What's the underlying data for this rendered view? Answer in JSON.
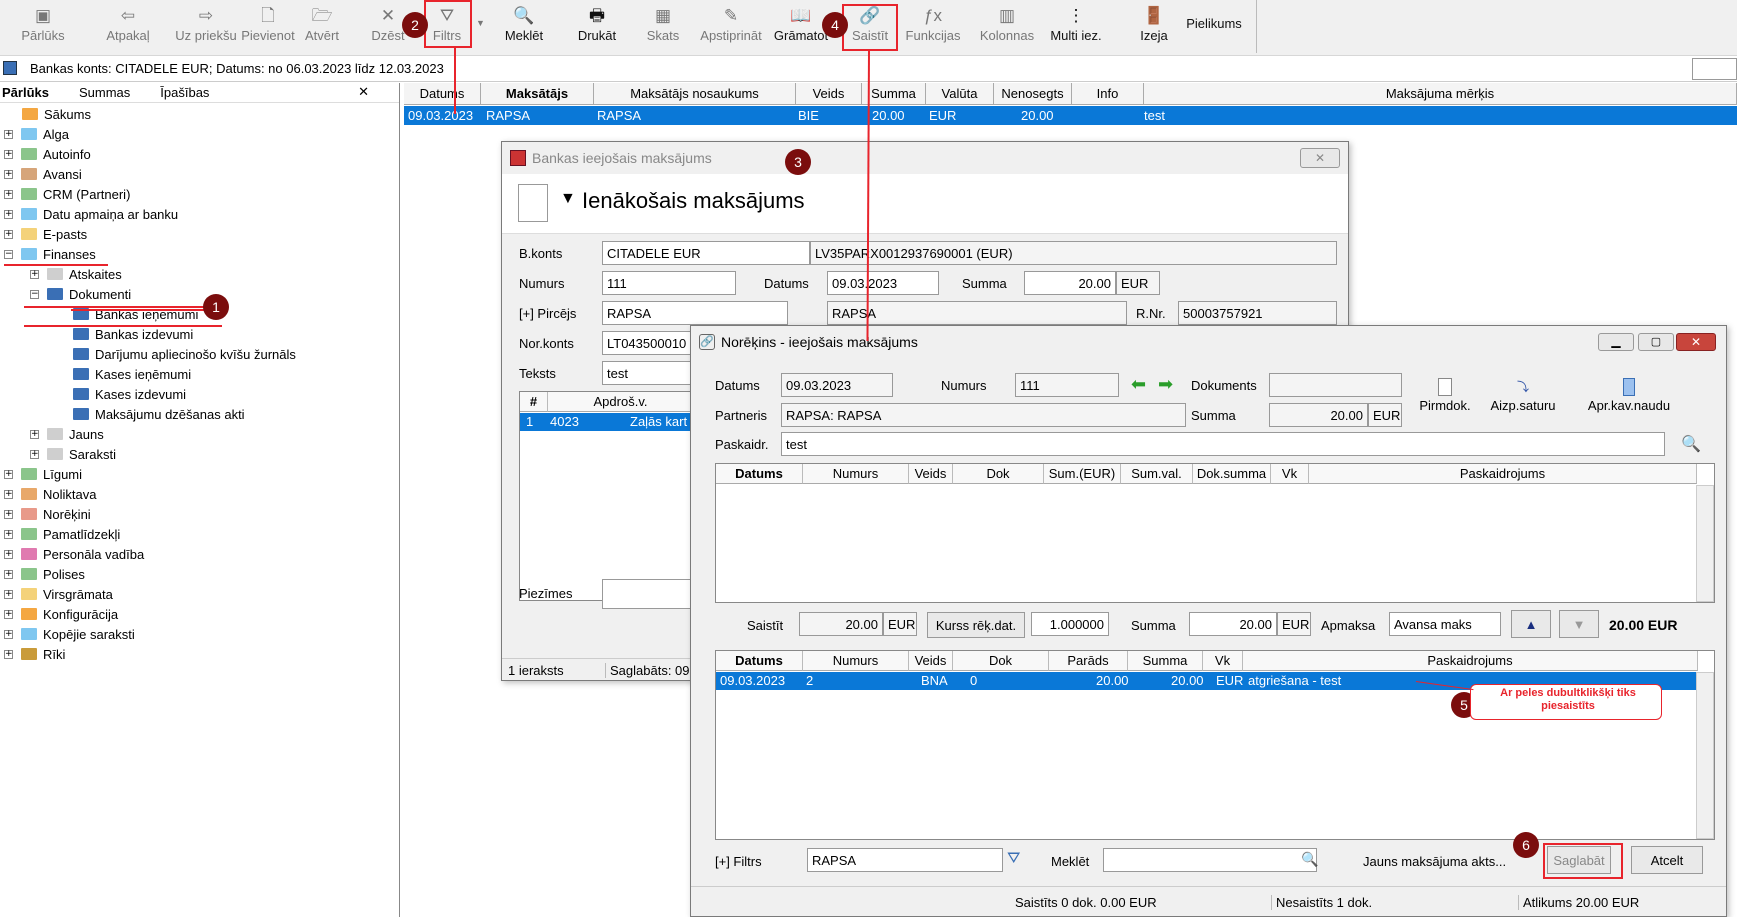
{
  "toolbar": {
    "items": [
      {
        "label": "Pārlūks",
        "icon": "browser-icon",
        "glyph": "▣",
        "enabled": false
      },
      {
        "label": "Atpakaļ",
        "icon": "back-arrow-icon",
        "glyph": "⇦",
        "enabled": false
      },
      {
        "label": "Uz priekšu",
        "icon": "forward-arrow-icon",
        "glyph": "⇨",
        "enabled": false
      },
      {
        "label": "Pievienot",
        "icon": "new-document-icon",
        "glyph": "🗋",
        "enabled": false
      },
      {
        "label": "Atvērt",
        "icon": "open-folder-icon",
        "glyph": "🗁",
        "enabled": false
      },
      {
        "label": "Dzēst",
        "icon": "delete-x-icon",
        "glyph": "✕",
        "enabled": false
      },
      {
        "label": "Filtrs",
        "icon": "filter-icon",
        "glyph": "⛛",
        "enabled": false
      },
      {
        "label": "Meklēt",
        "icon": "search-icon",
        "glyph": "🔍",
        "enabled": true
      },
      {
        "label": "Drukāt",
        "icon": "printer-icon",
        "glyph": "🖶",
        "enabled": true
      },
      {
        "label": "Skats",
        "icon": "view-grid-icon",
        "glyph": "▦",
        "enabled": false
      },
      {
        "label": "Apstiprināt",
        "icon": "approve-icon",
        "glyph": "✎",
        "enabled": false
      },
      {
        "label": "Grāmatot",
        "icon": "book-icon",
        "glyph": "📖",
        "enabled": true
      },
      {
        "label": "Saistīt",
        "icon": "link-icon",
        "glyph": "🔗",
        "enabled": false
      },
      {
        "label": "Funkcijas",
        "icon": "function-icon",
        "glyph": "ƒx",
        "enabled": false
      },
      {
        "label": "Kolonnas",
        "icon": "columns-icon",
        "glyph": "▥",
        "enabled": false
      },
      {
        "label": "Multi iez.",
        "icon": "more-vertical-icon",
        "glyph": "⋮",
        "enabled": true
      },
      {
        "label": "Izeja",
        "icon": "exit-door-icon",
        "glyph": "🚪",
        "enabled": true
      }
    ],
    "extra_label": "Pielikums"
  },
  "info_bar": {
    "text": "Bankas konts: CITADELE EUR; Datums: no 06.03.2023 līdz 12.03.2023"
  },
  "left_panel": {
    "tabs": [
      "Pārlūks",
      "Summas",
      "Īpašības"
    ],
    "close": "✕",
    "tree": [
      {
        "label": "Sākums",
        "level": 0,
        "pm": "",
        "color": "#f4a742"
      },
      {
        "label": "Alga",
        "level": 0,
        "pm": "+",
        "color": "#7fc7f0"
      },
      {
        "label": "Autoinfo",
        "level": 0,
        "pm": "+",
        "color": "#8bc58b"
      },
      {
        "label": "Avansi",
        "level": 0,
        "pm": "+",
        "color": "#d6a57a"
      },
      {
        "label": "CRM (Partneri)",
        "level": 0,
        "pm": "+",
        "color": "#8bc58b"
      },
      {
        "label": "Datu apmaiņa ar banku",
        "level": 0,
        "pm": "+",
        "color": "#7fc7f0"
      },
      {
        "label": "E-pasts",
        "level": 0,
        "pm": "+",
        "color": "#f4d27a"
      },
      {
        "label": "Finanses",
        "level": 0,
        "pm": "−",
        "color": "#7fc7f0"
      },
      {
        "label": "Atskaites",
        "level": 1,
        "pm": "+",
        "color": "#cfcfcf"
      },
      {
        "label": "Dokumenti",
        "level": 1,
        "pm": "−",
        "color": "#3a6fb5"
      },
      {
        "label": "Bankas ieņēmumi",
        "level": 2,
        "pm": "",
        "color": "#3a6fb5"
      },
      {
        "label": "Bankas izdevumi",
        "level": 2,
        "pm": "",
        "color": "#3a6fb5"
      },
      {
        "label": "Darījumu apliecinošo kvīšu žurnāls",
        "level": 2,
        "pm": "",
        "color": "#3a6fb5"
      },
      {
        "label": "Kases ieņēmumi",
        "level": 2,
        "pm": "",
        "color": "#3a6fb5"
      },
      {
        "label": "Kases izdevumi",
        "level": 2,
        "pm": "",
        "color": "#3a6fb5"
      },
      {
        "label": "Maksājumu dzēšanas akti",
        "level": 2,
        "pm": "",
        "color": "#3a6fb5"
      },
      {
        "label": "Jauns",
        "level": 1,
        "pm": "+",
        "color": "#cfcfcf"
      },
      {
        "label": "Saraksti",
        "level": 1,
        "pm": "+",
        "color": "#cfcfcf"
      },
      {
        "label": "Līgumi",
        "level": 0,
        "pm": "+",
        "color": "#8bc58b"
      },
      {
        "label": "Noliktava",
        "level": 0,
        "pm": "+",
        "color": "#e8a86a"
      },
      {
        "label": "Norēķini",
        "level": 0,
        "pm": "+",
        "color": "#e89a8a"
      },
      {
        "label": "Pamatlīdzekļi",
        "level": 0,
        "pm": "+",
        "color": "#8bc58b"
      },
      {
        "label": "Personāla vadība",
        "level": 0,
        "pm": "+",
        "color": "#e07ab0"
      },
      {
        "label": "Polises",
        "level": 0,
        "pm": "+",
        "color": "#8bc58b"
      },
      {
        "label": "Virsgrāmata",
        "level": 0,
        "pm": "+",
        "color": "#f4d27a"
      },
      {
        "label": "Konfigurācija",
        "level": 0,
        "pm": "+",
        "color": "#f4a742"
      },
      {
        "label": "Kopējie saraksti",
        "level": 0,
        "pm": "+",
        "color": "#7fc7f0"
      },
      {
        "label": "Rīki",
        "level": 0,
        "pm": "+",
        "color": "#c99b3a"
      }
    ]
  },
  "main_grid": {
    "columns": [
      "Datums",
      "Maksātājs",
      "Maksātājs nosaukums",
      "Veids",
      "Summa",
      "Valūta",
      "Nenosegts",
      "Info",
      "Maksājuma mērķis"
    ],
    "row": {
      "datums": "09.03.2023",
      "maksatajs": "RAPSA",
      "nosaukums": "RAPSA",
      "veids": "BIE",
      "summa": "20.00",
      "valuta": "EUR",
      "nenosegts": "20.00",
      "merkis": "test"
    }
  },
  "bank_dialog": {
    "title": "Bankas ieejošais maksājums",
    "heading": "Ienākošais maksājums",
    "bkonts_label": "B.konts",
    "bkonts": "CITADELE EUR",
    "iban": "LV35PARX0012937690001 (EUR)",
    "numurs_label": "Numurs",
    "numurs": "111",
    "datums_label": "Datums",
    "datums": "09.03.2023",
    "summa_label": "Summa",
    "summa": "20.00",
    "valuta": "EUR",
    "pircejs_label": "[+] Pircējs",
    "pircejs": "RAPSA",
    "pircejs_name": "RAPSA",
    "rnr_label": "R.Nr.",
    "rnr": "50003757921",
    "norkonts_label": "Nor.konts",
    "norkonts": "LT043500010",
    "teksts_label": "Teksts",
    "teksts": "test",
    "grid_cols": [
      "#",
      "Apdroš.v."
    ],
    "grid_row": {
      "n": "1",
      "v": "4023",
      "t": "Zaļās kart"
    },
    "piezimes_label": "Piezīmes",
    "status1": "1 ieraksts",
    "status2": "Saglabāts: 09"
  },
  "settle_dialog": {
    "title": "Norēķins - ieejošais maksājums",
    "datums_label": "Datums",
    "datums": "09.03.2023",
    "numurs_label": "Numurs",
    "numurs": "111",
    "dokuments_label": "Dokuments",
    "dokuments": "",
    "partneris_label": "Partneris",
    "partneris": "RAPSA: RAPSA",
    "summa_label": "Summa",
    "summa": "20.00",
    "valuta": "EUR",
    "paskaidr_label": "Paskaidr.",
    "paskaidr": "test",
    "pirmdok": "Pirmdok.",
    "aizp": "Aizp.saturu",
    "apr": "Apr.kav.naudu",
    "top_cols": [
      "Datums",
      "Numurs",
      "Veids",
      "Dok",
      "Sum.(EUR)",
      "Sum.val.",
      "Dok.summa",
      "Vk",
      "Paskaidrojums"
    ],
    "saistit_label": "Saistīt",
    "saistit": "20.00",
    "saistit_val": "EUR",
    "kurss_btn": "Kurss rēķ.dat.",
    "kurss": "1.000000",
    "summa2_label": "Summa",
    "summa2": "20.00",
    "summa2_val": "EUR",
    "apmaksa_label": "Apmaksa",
    "apmaksa": "Avansa maks",
    "total": "20.00 EUR",
    "bottom_cols": [
      "Datums",
      "Numurs",
      "Veids",
      "Dok",
      "Parāds",
      "Summa",
      "Vk",
      "Paskaidrojums"
    ],
    "bottom_row": {
      "datums": "09.03.2023",
      "numurs": "2",
      "veids": "BNA",
      "dok": "0",
      "parads": "20.00",
      "summa": "20.00",
      "vk": "EUR",
      "pask": "atgriešana - test"
    },
    "filtrs_label": "[+] Filtrs",
    "filtrs": "RAPSA",
    "meklet_label": "Meklēt",
    "meklet": "",
    "jauns": "Jauns maksājuma akts...",
    "saglabat": "Saglabāt",
    "atcelt": "Atcelt",
    "status1": "Saistīts 0 dok. 0.00 EUR",
    "status2": "Nesaistīts 1 dok.",
    "status3": "Atlikums 20.00 EUR"
  },
  "annotations": {
    "b1": "1",
    "b2": "2",
    "b3": "3",
    "b4": "4",
    "b5": "5",
    "b6": "6",
    "callout": "Ar peles dubultklikšķi tiks piesaistīts",
    "accent": "#e8242c",
    "badge_color": "#7b0d0d",
    "selection": "#0a78d7"
  }
}
